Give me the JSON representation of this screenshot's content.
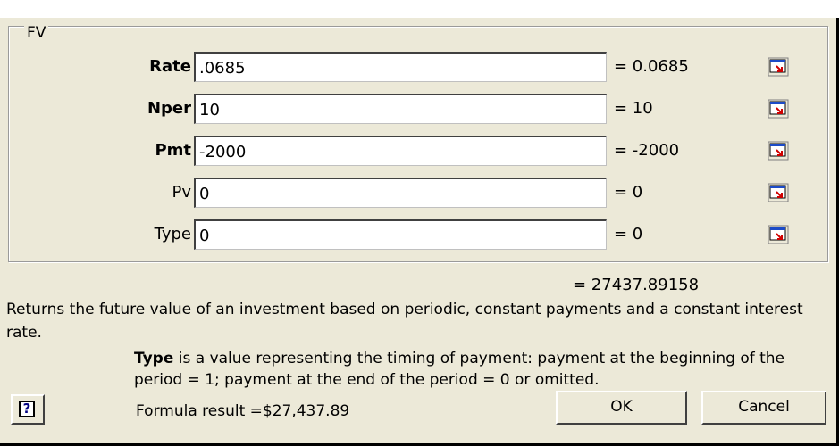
{
  "function_group": {
    "title": "FV"
  },
  "arguments": [
    {
      "label": "Rate",
      "bold": true,
      "value": ".0685",
      "result": "= 0.0685"
    },
    {
      "label": "Nper",
      "bold": true,
      "value": "10",
      "result": "= 10"
    },
    {
      "label": "Pmt",
      "bold": true,
      "value": "-2000",
      "result": "= -2000"
    },
    {
      "label": "Pv",
      "bold": false,
      "value": "0",
      "result": "= 0"
    },
    {
      "label": "Type",
      "bold": false,
      "value": "0",
      "result": "= 0"
    }
  ],
  "total_result": "= 27437.89158",
  "description": "Returns the future value of an investment based on periodic, constant payments and a constant interest rate.",
  "arg_help": {
    "name": "Type",
    "text": "is a value representing the timing of payment: payment at the beginning of the period = 1; payment at the end of the period = 0 or omitted."
  },
  "formula_result": "Formula result =$27,437.89",
  "buttons": {
    "ok": "OK",
    "cancel": "Cancel"
  },
  "icons": {
    "help": "help-question-icon",
    "collapse": "collapse-dialog-icon"
  }
}
